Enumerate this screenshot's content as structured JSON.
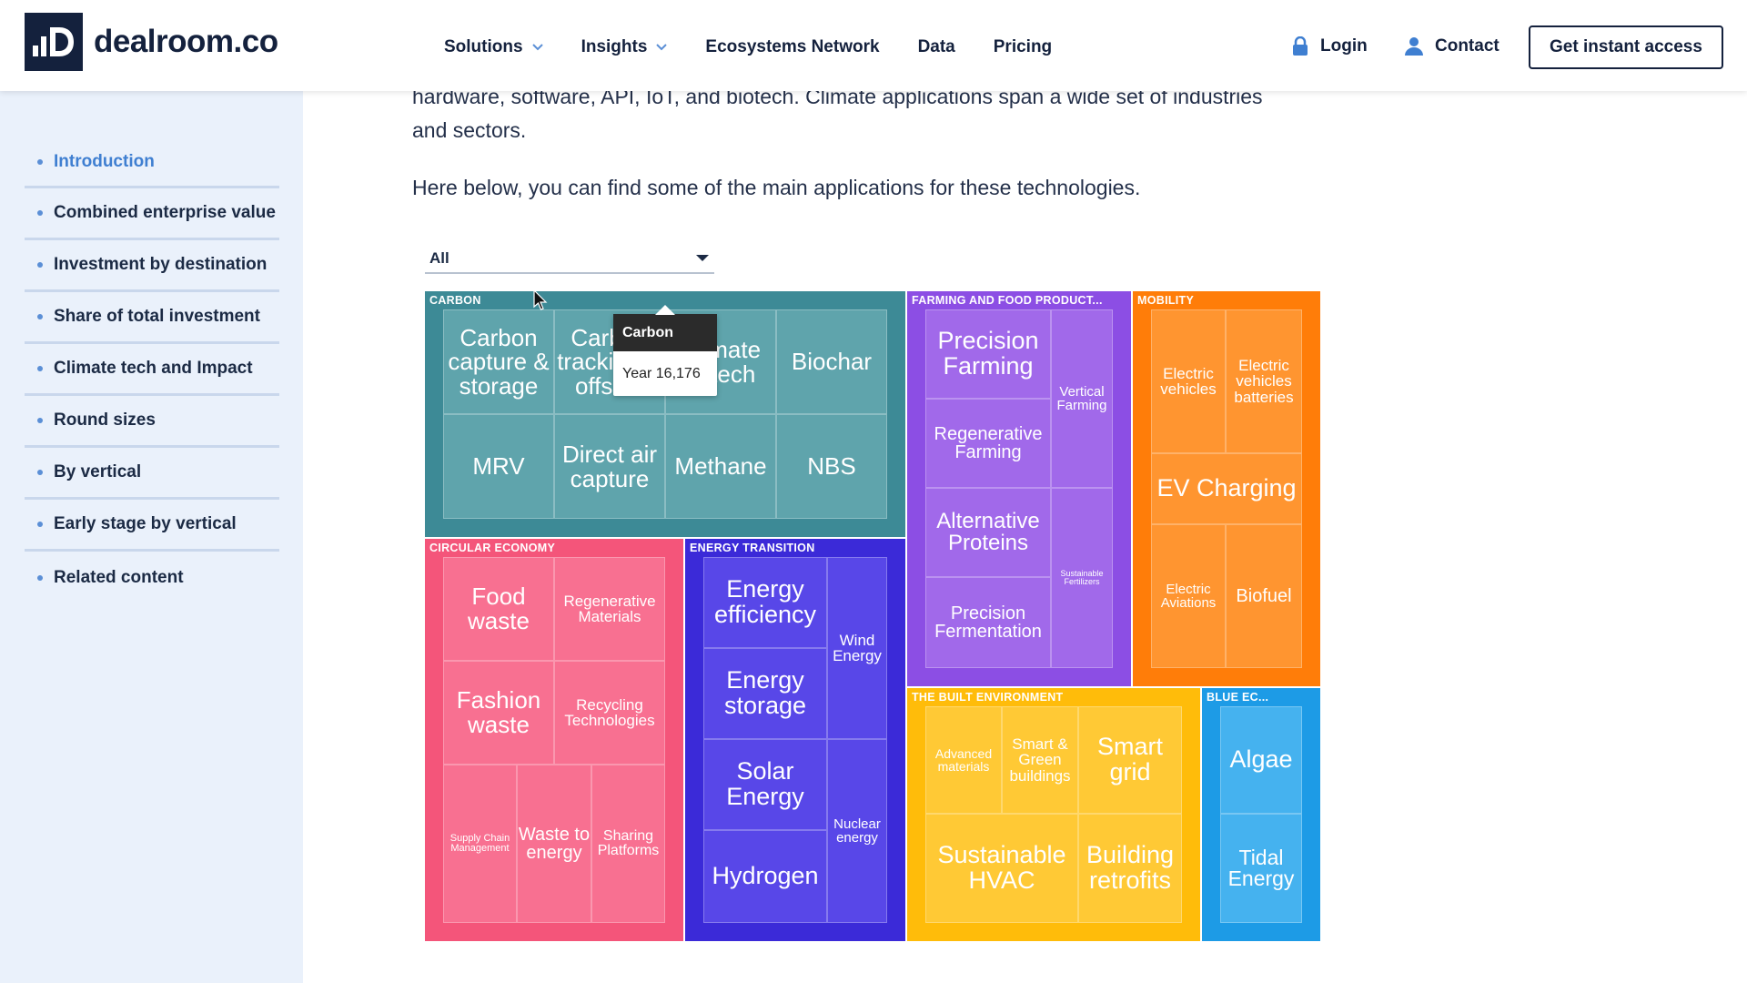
{
  "header": {
    "logo_text": "dealroom.co",
    "nav": [
      {
        "label": "Solutions",
        "has_dropdown": true
      },
      {
        "label": "Insights",
        "has_dropdown": true
      },
      {
        "label": "Ecosystems Network",
        "has_dropdown": false
      },
      {
        "label": "Data",
        "has_dropdown": false
      },
      {
        "label": "Pricing",
        "has_dropdown": false
      }
    ],
    "login_label": "Login",
    "contact_label": "Contact",
    "cta_label": "Get instant access"
  },
  "sidebar": {
    "items": [
      {
        "label": "Introduction",
        "active": true
      },
      {
        "label": "Combined enterprise value"
      },
      {
        "label": "Investment by destination"
      },
      {
        "label": "Share of total investment"
      },
      {
        "label": "Climate tech and Impact"
      },
      {
        "label": "Round sizes"
      },
      {
        "label": "By vertical"
      },
      {
        "label": "Early stage by vertical"
      },
      {
        "label": "Related content"
      }
    ]
  },
  "article": {
    "para1_line1": "hardware, software, API, IoT, and biotech. Climate applications span a wide set of industries",
    "para1_line2": "and sectors.",
    "para2": "Here below, you can find some of the main applications for these technologies."
  },
  "filter": {
    "selected": "All"
  },
  "tooltip": {
    "title": "Carbon",
    "body": "Year 16,176"
  },
  "treemap": {
    "groups": {
      "carbon": {
        "label": "CARBON",
        "color": "#3d8a96",
        "tile_color": "#5fa4ac",
        "tiles": [
          "Carbon capture & storage",
          "Carbon tracking & offsets",
          "Climate fintech",
          "Biochar",
          "MRV",
          "Direct air capture",
          "Methane",
          "NBS"
        ]
      },
      "farming": {
        "label": "FARMING AND FOOD PRODUCT...",
        "color": "#8c4ee4",
        "tile_color": "#a169ea",
        "tiles": [
          "Precision Farming",
          "Regenerative Farming",
          "Alternative Proteins",
          "Precision Fermentation",
          "Vertical Farming",
          "Sustainable Fertilizers"
        ]
      },
      "mobility": {
        "label": "MOBILITY",
        "color": "#ff7d09",
        "tile_color": "#ff9530",
        "tiles": [
          "Electric vehicles",
          "Electric vehicles batteries",
          "EV Charging",
          "Electric Aviations",
          "Biofuel"
        ]
      },
      "circular": {
        "label": "CIRCULAR ECONOMY",
        "color": "#f4557a",
        "tile_color": "#f87091",
        "tiles": [
          "Food waste",
          "Regenerative Materials",
          "Fashion waste",
          "Recycling Technologies",
          "Supply Chain Management",
          "Waste to energy",
          "Sharing Platforms"
        ]
      },
      "energy": {
        "label": "ENERGY TRANSITION",
        "color": "#3b2ad8",
        "tile_color": "#5847e8",
        "tiles": [
          "Energy efficiency",
          "Energy storage",
          "Solar Energy",
          "Hydrogen",
          "Wind Energy",
          "Nuclear energy"
        ]
      },
      "built": {
        "label": "THE BUILT ENVIRONMENT",
        "color": "#ffbc0a",
        "tile_color": "#ffc935",
        "tiles": [
          "Advanced materials",
          "Smart & Green buildings",
          "Smart grid",
          "Sustainable HVAC",
          "Building retrofits"
        ]
      },
      "blue": {
        "label": "BLUE EC...",
        "color": "#1d9be6",
        "tile_color": "#45b2ef",
        "tiles": [
          "Algae",
          "Tidal Energy"
        ]
      }
    }
  }
}
